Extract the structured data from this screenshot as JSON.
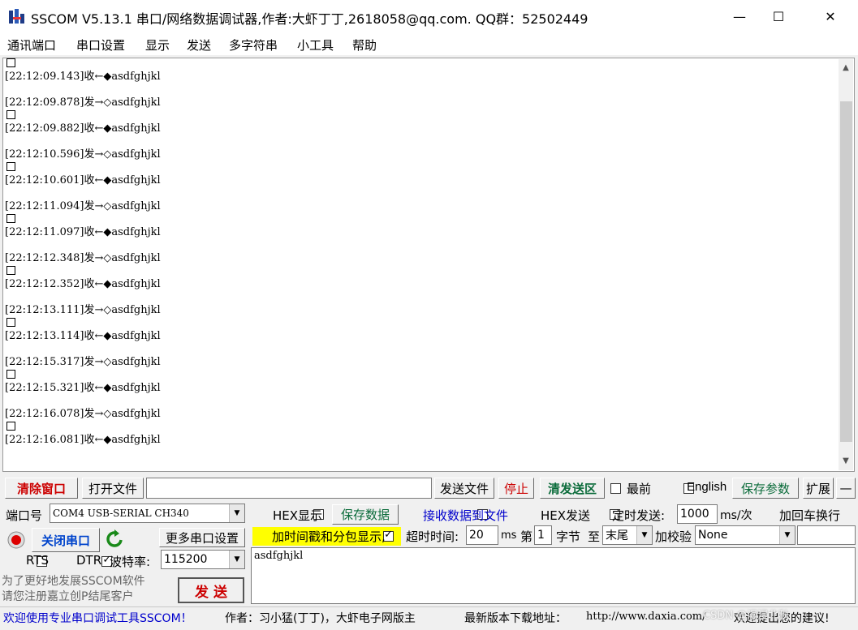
{
  "window": {
    "title": "SSCOM V5.13.1 串口/网络数据调试器,作者:大虾丁丁,2618058@qq.com. QQ群：52502449",
    "minimize": "—",
    "maximize": "☐",
    "close": "✕"
  },
  "menu": [
    "通讯端口",
    "串口设置",
    "显示",
    "发送",
    "多字符串",
    "小工具",
    "帮助"
  ],
  "log": [
    {
      "time": "[22:12:09.143]",
      "dir": "收←◆",
      "text": "asdfghjkl"
    },
    {
      "time": "[22:12:09.878]",
      "dir": "发→◇",
      "text": "asdfghjkl"
    },
    {
      "time": "[22:12:09.882]",
      "dir": "收←◆",
      "text": "asdfghjkl"
    },
    {
      "time": "[22:12:10.596]",
      "dir": "发→◇",
      "text": "asdfghjkl"
    },
    {
      "time": "[22:12:10.601]",
      "dir": "收←◆",
      "text": "asdfghjkl"
    },
    {
      "time": "[22:12:11.094]",
      "dir": "发→◇",
      "text": "asdfghjkl"
    },
    {
      "time": "[22:12:11.097]",
      "dir": "收←◆",
      "text": "asdfghjkl"
    },
    {
      "time": "[22:12:12.348]",
      "dir": "发→◇",
      "text": "asdfghjkl"
    },
    {
      "time": "[22:12:12.352]",
      "dir": "收←◆",
      "text": "asdfghjkl"
    },
    {
      "time": "[22:12:13.111]",
      "dir": "发→◇",
      "text": "asdfghjkl"
    },
    {
      "time": "[22:12:13.114]",
      "dir": "收←◆",
      "text": "asdfghjkl"
    },
    {
      "time": "[22:12:15.317]",
      "dir": "发→◇",
      "text": "asdfghjkl"
    },
    {
      "time": "[22:12:15.321]",
      "dir": "收←◆",
      "text": "asdfghjkl"
    },
    {
      "time": "[22:12:16.078]",
      "dir": "发→◇",
      "text": "asdfghjkl"
    },
    {
      "time": "[22:12:16.081]",
      "dir": "收←◆",
      "text": "asdfghjkl"
    }
  ],
  "toolbar": {
    "clear_window": "清除窗口",
    "open_file": "打开文件",
    "send_file": "发送文件",
    "stop": "停止",
    "clear_send": "清发送区",
    "topmost": "最前",
    "english": "English",
    "save_params": "保存参数",
    "expand": "扩展",
    "collapse": "—"
  },
  "port": {
    "port_label": "端口号",
    "port_value": "COM4 USB-SERIAL CH340",
    "close_port": "关闭串口",
    "more_settings": "更多串口设置",
    "rts": "RTS",
    "dtr": "DTR",
    "baud_label": "波特率:",
    "baud_value": "115200"
  },
  "options": {
    "hex_display": "HEX显示",
    "save_data": "保存数据",
    "recv_to_file": "接收数据到文件",
    "hex_send": "HEX发送",
    "timed_send": "定时发送:",
    "interval": "1000",
    "interval_unit": "ms/次",
    "append_newline": "加回车换行",
    "timestamp": "加时间戳和分包显示,",
    "timeout_label": "超时时间:",
    "timeout_value": "20",
    "timeout_unit": "ms",
    "nth_label": "第",
    "nth_value": "1",
    "byte_label": "字节",
    "to_label": "至",
    "end_value": "末尾",
    "checksum_label": "加校验",
    "checksum_value": "None"
  },
  "promo": {
    "line1": "为了更好地发展SSCOM软件",
    "line2": "请您注册嘉立创P结尾客户"
  },
  "send": {
    "button": "发 送",
    "content": "asdfghjkl"
  },
  "status": {
    "welcome": "欢迎使用专业串口调试工具SSCOM！",
    "author": "作者：习小猛(丁丁)，大虾电子网版主",
    "download_label": "最新版本下载地址：",
    "url": "http://www.daxia.com/",
    "trailing": "欢迎提出您的建议!",
    "watermark": "CSDN @漫浸北秋"
  },
  "colors": {
    "highlight_yellow": "#ffff00",
    "blue_text": "#0000cc",
    "green_text": "#008000",
    "red_text": "#cc0000"
  }
}
